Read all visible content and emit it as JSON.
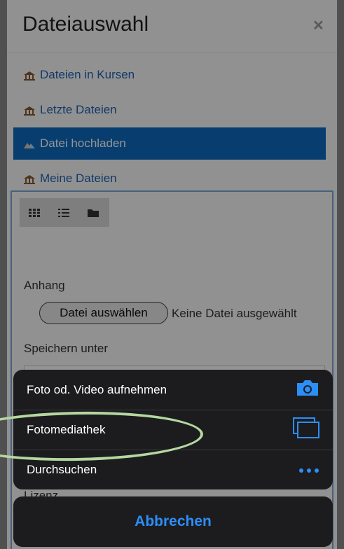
{
  "dialog": {
    "title": "Dateiauswahl",
    "close_icon": "close-icon"
  },
  "repositories": [
    {
      "label": "Dateien in Kursen",
      "icon": "repository-icon",
      "active": false
    },
    {
      "label": "Letzte Dateien",
      "icon": "repository-icon",
      "active": false
    },
    {
      "label": "Datei hochladen",
      "icon": "upload-icon",
      "active": true
    },
    {
      "label": "Meine Dateien",
      "icon": "repository-icon",
      "active": false
    }
  ],
  "view_buttons": [
    "grid-view-icon",
    "list-view-icon",
    "folder-view-icon"
  ],
  "upload_form": {
    "attachment_label": "Anhang",
    "choose_file_button": "Datei auswählen",
    "no_file_text": "Keine Datei ausgewählt",
    "save_as_label": "Speichern unter",
    "license_label": "Lizenz"
  },
  "action_sheet": {
    "items": [
      {
        "label": "Foto od. Video aufnehmen",
        "icon": "camera-icon"
      },
      {
        "label": "Fotomediathek",
        "icon": "photo-library-icon"
      },
      {
        "label": "Durchsuchen",
        "icon": "more-icon"
      }
    ],
    "cancel_label": "Abbrechen"
  },
  "colors": {
    "link": "#1f63b6",
    "active_bg": "#0f6cbf",
    "ios_blue": "#2c8ef8",
    "sheet_bg": "#1c1c1e",
    "highlight": "#b4d7a0"
  }
}
